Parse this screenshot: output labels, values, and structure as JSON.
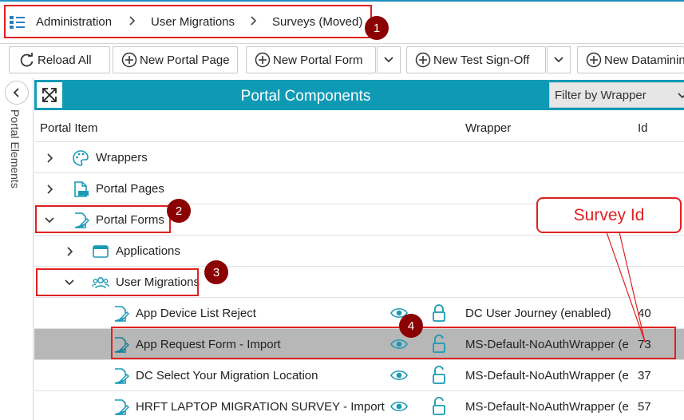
{
  "breadcrumb": {
    "items": [
      "Administration",
      "User Migrations",
      "Surveys (Moved)"
    ],
    "icon": "list-settings-icon"
  },
  "toolbar": {
    "reload": "Reload All",
    "new_portal_page": "New Portal Page",
    "new_portal_form": "New Portal Form",
    "new_test_signoff": "New Test Sign-Off",
    "new_datamining": "New Datamining"
  },
  "side_panel": {
    "label": "Portal Elements"
  },
  "header": {
    "title": "Portal Components",
    "filter_placeholder": "Filter by Wrapper"
  },
  "columns": {
    "item": "Portal Item",
    "wrapper": "Wrapper",
    "id": "Id"
  },
  "tree": {
    "wrappers": "Wrappers",
    "portal_pages": "Portal Pages",
    "portal_forms": "Portal Forms",
    "applications": "Applications",
    "user_migrations": "User Migrations",
    "forms": [
      {
        "name": "App Device List Reject",
        "wrapper": "DC User Journey (enabled)",
        "id": "40",
        "locked": true
      },
      {
        "name": "App Request Form - Import",
        "wrapper": "MS-Default-NoAuthWrapper (enabled)",
        "id": "73",
        "locked": false,
        "selected": true
      },
      {
        "name": "DC Select Your Migration Location",
        "wrapper": "MS-Default-NoAuthWrapper (enabled)",
        "id": "37",
        "locked": false
      },
      {
        "name": "HRFT LAPTOP MIGRATION SURVEY  - Import",
        "wrapper": "MS-Default-NoAuthWrapper (enabled)",
        "id": "57",
        "locked": false
      }
    ]
  },
  "annotations": {
    "badges": [
      "1",
      "2",
      "3",
      "4"
    ],
    "callout": "Survey Id"
  },
  "colors": {
    "accent": "#0e9ab5",
    "annotation_red": "#e02020",
    "badge": "#8b0000",
    "selected_row": "#b7b7b7"
  }
}
